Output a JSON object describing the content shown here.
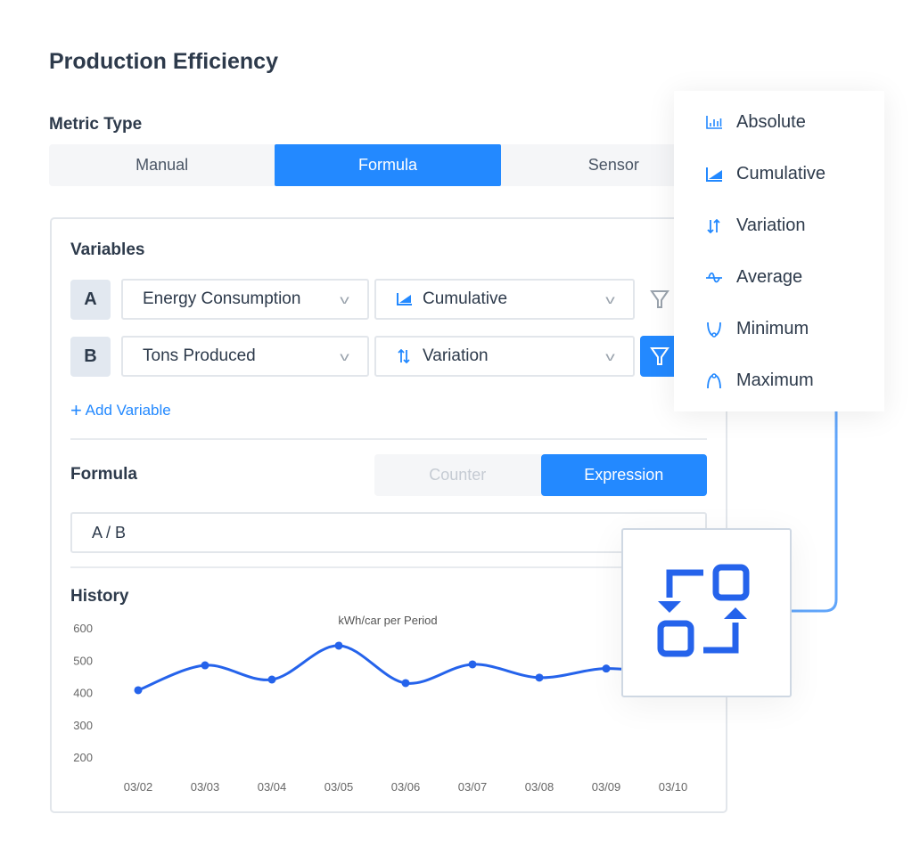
{
  "title": "Production Efficiency",
  "metric_type": {
    "label": "Metric Type",
    "options": [
      "Manual",
      "Formula",
      "Sensor"
    ],
    "selected": "Formula"
  },
  "variables": {
    "label": "Variables",
    "rows": [
      {
        "letter": "A",
        "source": "Energy Consumption",
        "aggregation": "Cumulative",
        "aggregation_icon": "area-chart-icon",
        "filter_active": false
      },
      {
        "letter": "B",
        "source": "Tons Produced",
        "aggregation": "Variation",
        "aggregation_icon": "up-down-arrows-icon",
        "filter_active": true
      }
    ],
    "add_label": "Add Variable"
  },
  "formula": {
    "label": "Formula",
    "modes": [
      "Counter",
      "Expression"
    ],
    "selected": "Expression",
    "value": "A / B"
  },
  "history": {
    "label": "History"
  },
  "aggregation_menu": {
    "items": [
      {
        "label": "Absolute",
        "icon": "bar-chart-icon"
      },
      {
        "label": "Cumulative",
        "icon": "area-chart-icon"
      },
      {
        "label": "Variation",
        "icon": "up-down-arrows-icon"
      },
      {
        "label": "Average",
        "icon": "wave-icon"
      },
      {
        "label": "Minimum",
        "icon": "minimum-curve-icon"
      },
      {
        "label": "Maximum",
        "icon": "maximum-curve-icon"
      }
    ]
  },
  "overlay_icon": "swap-squares-icon",
  "colors": {
    "accent": "#2389ff",
    "line": "#2563eb",
    "connector": "#60a5fa"
  },
  "chart_data": {
    "type": "line",
    "title": "kWh/car per Period",
    "categories": [
      "03/02",
      "03/03",
      "03/04",
      "03/05",
      "03/06",
      "03/07",
      "03/08",
      "03/09",
      "03/10"
    ],
    "values": [
      407,
      484,
      440,
      545,
      429,
      487,
      446,
      474,
      455
    ],
    "yticks": [
      600,
      500,
      400,
      300,
      200
    ],
    "ylim": [
      200,
      600
    ],
    "grid": false,
    "smooth": true
  }
}
